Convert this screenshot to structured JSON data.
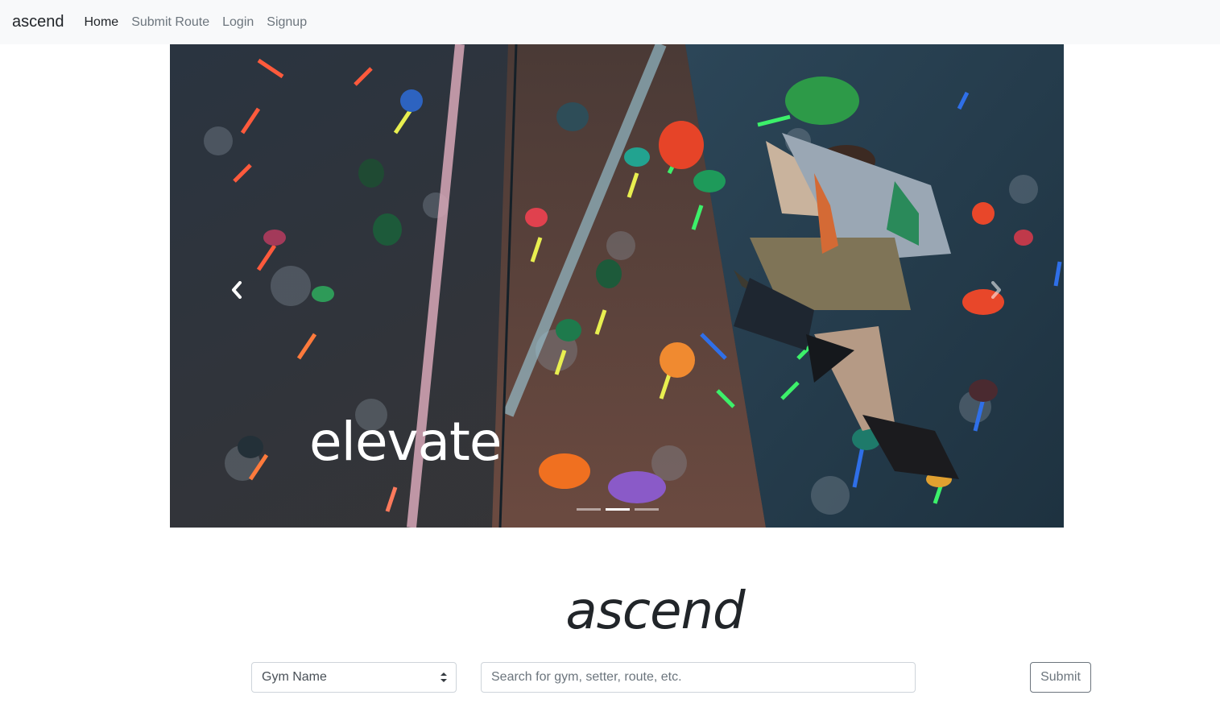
{
  "navbar": {
    "brand": "ascend",
    "links": [
      {
        "label": "Home",
        "active": true
      },
      {
        "label": "Submit Route",
        "active": false
      },
      {
        "label": "Login",
        "active": false
      },
      {
        "label": "Signup",
        "active": false
      }
    ]
  },
  "carousel": {
    "caption": "elevate",
    "prev_icon": "chevron-left-icon",
    "next_icon": "chevron-right-icon",
    "slides_count": 3,
    "active_slide": 2
  },
  "main": {
    "title": "ascend"
  },
  "search": {
    "filter_selected": "Gym Name",
    "placeholder": "Search for gym, setter, route, etc.",
    "value": "",
    "submit_label": "Submit"
  },
  "colors": {
    "navbar_bg": "#f8f9fa",
    "text_dark": "#212529",
    "text_muted": "#6c757d",
    "border": "#ced4da"
  }
}
